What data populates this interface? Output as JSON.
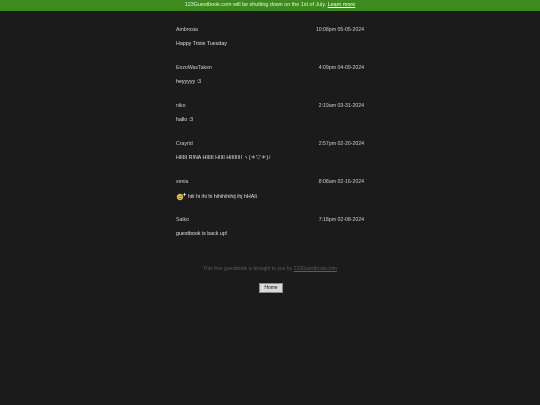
{
  "banner": {
    "text": "123Guestbook.com will be shutting down on the 1st of July.",
    "link_label": "Learn more"
  },
  "entries": [
    {
      "name": "Ambrosia",
      "time": "10:08pm 05-05-2024",
      "message": "Happy Trixie Tuesday"
    },
    {
      "name": "EnzoWasTaken",
      "time": "4:09pm 04-09-2024",
      "message": "heyyyyy :3"
    },
    {
      "name": "niko",
      "time": "2:19am 03-31-2024",
      "message": "hallo :3"
    },
    {
      "name": "Crayrid",
      "time": "2:57pm 02-20-2024",
      "message": "HIIIII RINA HIIIII HIIII HIIIIIIII ヽ(＊▽＊)ﾉ"
    },
    {
      "name": "xenia",
      "time": "8:08am 02-16-2024",
      "message": "hiii hi ihi hi hihihihihij ihj hHAIi",
      "icon": "sparkle-emoji-icon"
    },
    {
      "name": "Saiko",
      "time": "7:18pm 02-08-2024",
      "message": "guestbook is back up!"
    }
  ],
  "footer": {
    "text": "This free guestbook is brought to you by",
    "link_label": "123Guestbook.com"
  },
  "home_button": {
    "label": "Home"
  }
}
